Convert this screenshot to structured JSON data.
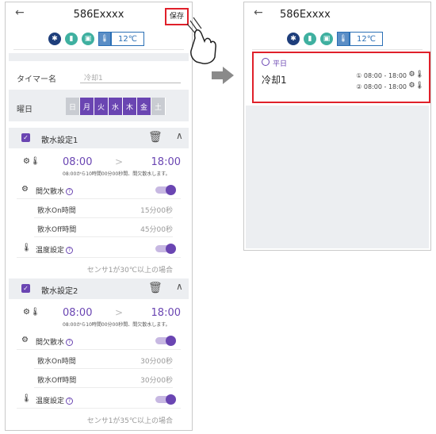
{
  "left": {
    "title": "586Exxxx",
    "save": "保存",
    "status_value": "12℃",
    "status_temp_unit": "℃",
    "timer_label": "タイマー名",
    "timer_placeholder": "冷却1",
    "weekday_label": "曜日",
    "days": [
      {
        "label": "日",
        "on": false
      },
      {
        "label": "月",
        "on": true
      },
      {
        "label": "火",
        "on": true
      },
      {
        "label": "水",
        "on": true
      },
      {
        "label": "木",
        "on": true
      },
      {
        "label": "金",
        "on": true
      },
      {
        "label": "土",
        "on": false
      }
    ],
    "settings": [
      {
        "title": "散水設定1",
        "start": "08:00",
        "end": "18:00",
        "note": "08:00から10時間00分00秒間、間欠散水します。",
        "intermittent_label": "間欠散水",
        "on_label": "散水On時間",
        "on_value": "15分00秒",
        "off_label": "散水Off時間",
        "off_value": "45分00秒",
        "temp_label": "温度設定",
        "condition": "センサ1が30℃以上の場合"
      },
      {
        "title": "散水設定2",
        "start": "08:00",
        "end": "18:00",
        "note": "08:00から10時間00分00秒間、間欠散水します。",
        "intermittent_label": "間欠散水",
        "on_label": "散水On時間",
        "on_value": "30分00秒",
        "off_label": "散水Off時間",
        "off_value": "30分00秒",
        "temp_label": "温度設定",
        "condition": "センサ1が35℃以上の場合"
      }
    ]
  },
  "right": {
    "title": "586Exxxx",
    "status_value": "12℃",
    "weekday": "平日",
    "timer_name": "冷却1",
    "schedules": [
      "① 08:00 - 18:00",
      "② 08:00 - 18:00"
    ]
  },
  "colors": {
    "accent": "#6a45b2",
    "highlight": "#e0202a",
    "arrow": "#8a8a8a"
  }
}
